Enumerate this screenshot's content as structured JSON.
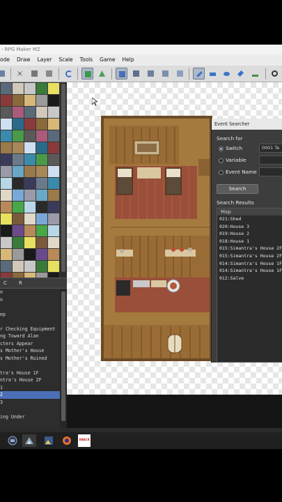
{
  "window": {
    "title": "- RPG Maker MZ"
  },
  "menu": [
    "ode",
    "Draw",
    "Layer",
    "Scale",
    "Tools",
    "Game",
    "Help"
  ],
  "tileset_tabs": [
    "C",
    "R"
  ],
  "map_list": [
    {
      "label": "n",
      "selected": false
    },
    {
      "label": "n",
      "selected": false
    },
    {
      "label": "",
      "selected": false
    },
    {
      "label": "ep",
      "selected": false
    },
    {
      "label": "",
      "selected": false
    },
    {
      "label": "r Checking Equipment",
      "selected": false
    },
    {
      "label": "ng Toward Alan",
      "selected": false
    },
    {
      "label": "cters Appear",
      "selected": false
    },
    {
      "label": "s Mother's House",
      "selected": false
    },
    {
      "label": "s Mother's Ruined",
      "selected": false
    },
    {
      "label": "",
      "selected": false
    },
    {
      "label": "tra's House 1F",
      "selected": false
    },
    {
      "label": "ntra's House 2F",
      "selected": false
    },
    {
      "label": " 1",
      "selected": false
    },
    {
      "label": " 2",
      "selected": true
    },
    {
      "label": " 3",
      "selected": false
    },
    {
      "label": "",
      "selected": false
    },
    {
      "label": "ing Under",
      "selected": false
    }
  ],
  "event_searcher": {
    "title": "Event Searcher",
    "search_for_label": "Search for",
    "options": [
      {
        "label": "Switch",
        "selected": true,
        "value": "0001 Ta"
      },
      {
        "label": "Variable",
        "selected": false,
        "value": ""
      },
      {
        "label": "Event Name",
        "selected": false,
        "value": ""
      }
    ],
    "search_button": "Search",
    "results_label": "Search Results",
    "results_header": "Map",
    "results": [
      "021:Shed",
      "020:House 3",
      "019:House 2",
      "018:House 1",
      "015:Simantra's House 2F",
      "015:Simantra's House 2F",
      "014:Simantra's House 1F",
      "014:Simantra's House 1F",
      "012:Salve"
    ]
  },
  "taskbar": {
    "icons": [
      "terminal-icon",
      "paint-icon",
      "photos-icon",
      "firefox-icon",
      "app-icon"
    ],
    "app_badge": "SNACK"
  },
  "colors": {
    "selection": "#4a6fb5",
    "wood": "#8a6232",
    "carpet": "#9a4f3a"
  }
}
